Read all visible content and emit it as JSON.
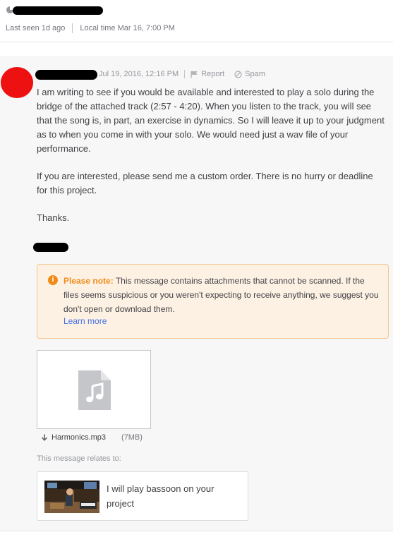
{
  "header": {
    "last_seen": "Last seen 1d ago",
    "local_time": "Local time Mar 16, 7:00 PM"
  },
  "message": {
    "timestamp": "Jul 19, 2016, 12:16 PM",
    "report_label": "Report",
    "spam_label": "Spam",
    "paragraph_1": "I am writing to see if you would be available and interested to play a solo during the bridge of the attached track (2:57 - 4:20). When you listen to the track, you will see that the song is, in part, an exercise in dynamics. So I will leave it up to your judgment as to when you come in with your solo. We would need just a wav file of your performance.",
    "paragraph_2": "If you are interested, please send me a custom order. There is no hurry or deadline for this project.",
    "paragraph_3": "Thanks."
  },
  "note": {
    "title": "Please note:",
    "text": " This message contains attachments that cannot be scanned. If the files seems suspicious or you weren't expecting to receive anything, we suggest you don't open or download them.",
    "link": "Learn more",
    "accent_color": "#f08c1a"
  },
  "attachment": {
    "filename": "Harmonics.mp3",
    "size": "(7MB)",
    "icon": "music-file-icon"
  },
  "relates": {
    "label": "This message relates to:",
    "gig_title": "I will play bassoon on your project"
  },
  "colors": {
    "avatar": "#ee1111",
    "link": "#446ee7",
    "thread_bg": "#f7f7f7"
  }
}
